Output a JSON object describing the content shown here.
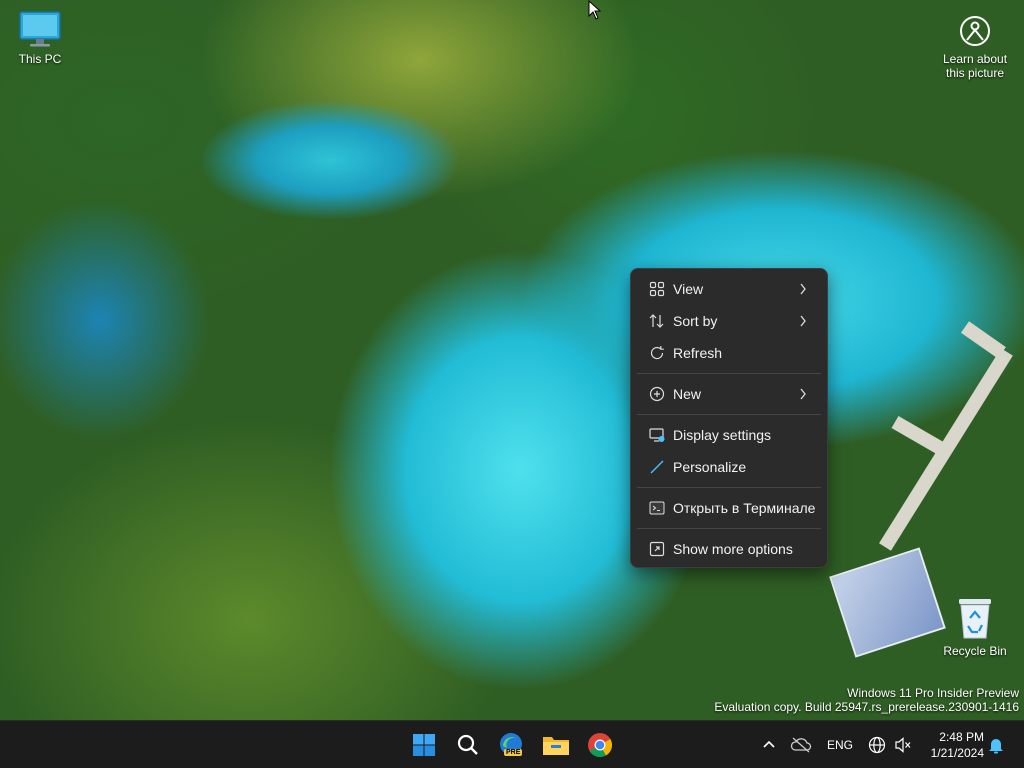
{
  "desktop": {
    "icons": [
      {
        "label": "This PC"
      },
      {
        "label": "Recycle Bin"
      }
    ],
    "spotlight": {
      "line1": "Learn about",
      "line2": "this picture"
    },
    "watermark": {
      "line1": "Windows 11 Pro Insider Preview",
      "line2": "Evaluation copy. Build 25947.rs_prerelease.230901-1416"
    }
  },
  "context_menu": {
    "items": [
      {
        "label": "View",
        "icon": "view-grid-icon",
        "submenu": true
      },
      {
        "label": "Sort by",
        "icon": "sort-icon",
        "submenu": true
      },
      {
        "label": "Refresh",
        "icon": "refresh-icon",
        "submenu": false
      },
      {
        "label": "New",
        "icon": "new-plus-icon",
        "submenu": true
      },
      {
        "label": "Display settings",
        "icon": "display-settings-icon",
        "submenu": false
      },
      {
        "label": "Personalize",
        "icon": "brush-icon",
        "submenu": false
      },
      {
        "label": "Открыть в Терминале",
        "icon": "terminal-icon",
        "submenu": false
      },
      {
        "label": "Show more options",
        "icon": "more-options-icon",
        "submenu": false
      }
    ]
  },
  "taskbar": {
    "apps": [
      "windows-start-icon",
      "search-icon",
      "edge-beta-icon",
      "file-explorer-icon",
      "chrome-icon"
    ],
    "edge_badge": "PRE",
    "tray": {
      "language": "ENG",
      "time": "2:48 PM",
      "date": "1/21/2024"
    }
  },
  "colors": {
    "menu_bg": "#2b2b2b",
    "taskbar_bg": "#1c1c1c",
    "accent": "#4cc2ff"
  }
}
